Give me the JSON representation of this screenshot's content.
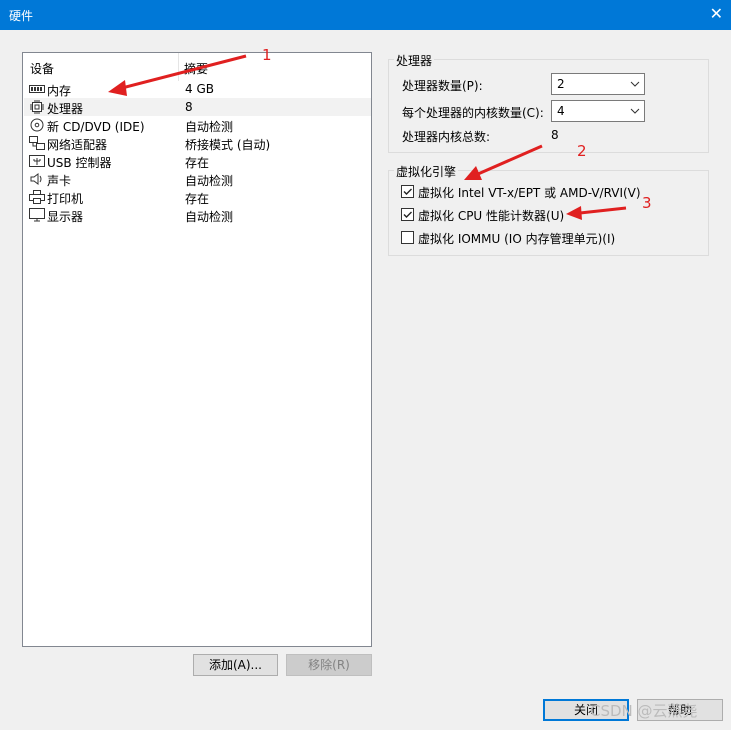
{
  "window": {
    "title": "硬件",
    "close_glyph": "✕"
  },
  "device_list": {
    "col_device": "设备",
    "col_summary": "摘要",
    "rows": [
      {
        "name": "内存",
        "summary": "4 GB",
        "icon": "memory-icon"
      },
      {
        "name": "处理器",
        "summary": "8",
        "icon": "processor-icon"
      },
      {
        "name": "新 CD/DVD (IDE)",
        "summary": "自动检测",
        "icon": "cd-dvd-icon"
      },
      {
        "name": "网络适配器",
        "summary": "桥接模式 (自动)",
        "icon": "network-adapter-icon"
      },
      {
        "name": "USB 控制器",
        "summary": "存在",
        "icon": "usb-icon"
      },
      {
        "name": "声卡",
        "summary": "自动检测",
        "icon": "sound-card-icon"
      },
      {
        "name": "打印机",
        "summary": "存在",
        "icon": "printer-icon"
      },
      {
        "name": "显示器",
        "summary": "自动检测",
        "icon": "display-icon"
      }
    ]
  },
  "buttons": {
    "add": "添加(A)...",
    "remove": "移除(R)",
    "close": "关闭",
    "help": "帮助"
  },
  "processors": {
    "title": "处理器",
    "count_label": "处理器数量(P):",
    "count_value": "2",
    "cores_label": "每个处理器的内核数量(C):",
    "cores_value": "4",
    "total_label": "处理器内核总数:",
    "total_value": "8"
  },
  "virtualization": {
    "title": "虚拟化引擎",
    "options": [
      {
        "label": "虚拟化 Intel VT-x/EPT 或 AMD-V/RVI(V)",
        "checked": true
      },
      {
        "label": "虚拟化 CPU 性能计数器(U)",
        "checked": true
      },
      {
        "label": "虚拟化 IOMMU (IO 内存管理单元)(I)",
        "checked": false
      }
    ]
  },
  "annotations": {
    "a1": "1",
    "a2": "2",
    "a3": "3",
    "arrow_color": "#e02020"
  },
  "watermark": "CSDN @云燕尧"
}
